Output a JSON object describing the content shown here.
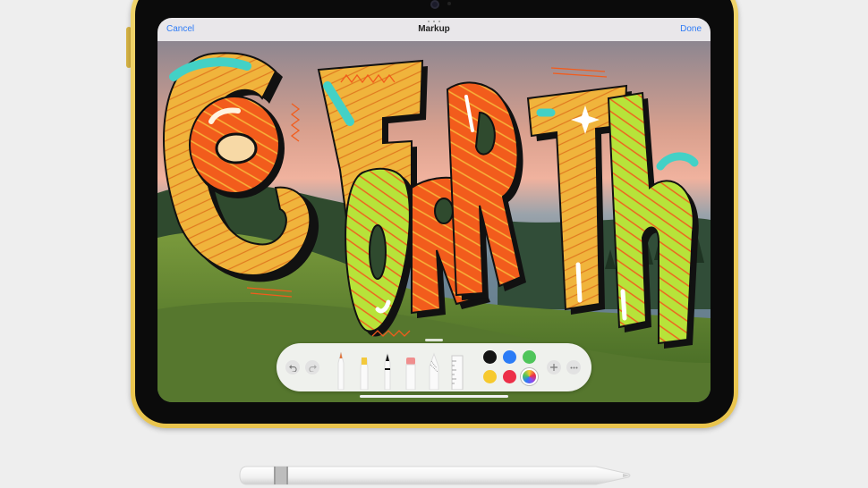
{
  "markup": {
    "title": "Markup",
    "cancel_label": "Cancel",
    "done_label": "Done"
  },
  "artwork": {
    "lettering": "GO FORTH"
  },
  "palette": {
    "undo_icon": "undo-icon",
    "redo_icon": "redo-icon",
    "tools": [
      "pen",
      "highlighter",
      "marker",
      "eraser",
      "lasso",
      "ruler"
    ],
    "colors": [
      "#141414",
      "#2b7cf6",
      "#4fc55a",
      "#f6c92e",
      "#ec2f48",
      "multicolor"
    ],
    "add_icon": "plus-icon",
    "more_icon": "ellipsis-icon"
  },
  "colors": {
    "device_gold": "#e9c44d",
    "link_blue": "#2f7cf6",
    "art_yellow": "#f0b43c",
    "art_orange": "#f25c1c",
    "art_lime": "#b7e33a",
    "art_cyan": "#43d1c6"
  }
}
